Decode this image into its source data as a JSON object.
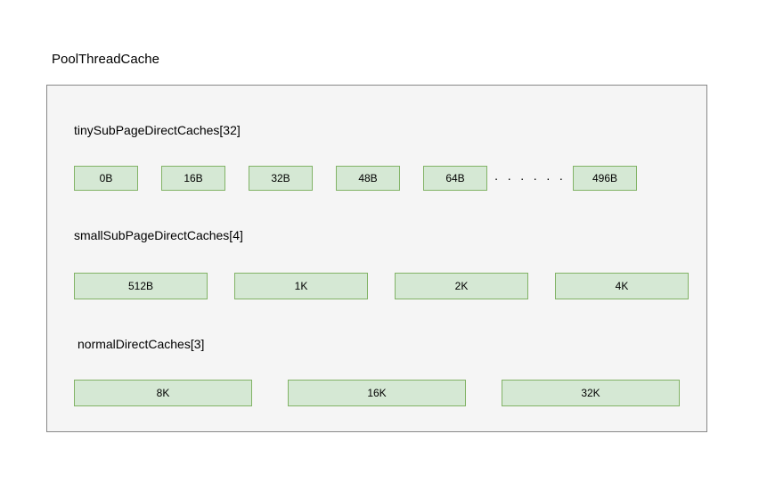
{
  "title": "PoolThreadCache",
  "sections": {
    "tiny": {
      "label": "tinySubPageDirectCaches[32]",
      "cells": [
        "0B",
        "16B",
        "32B",
        "48B",
        "64B"
      ],
      "ellipsis": "· · · · · ·",
      "last": "496B"
    },
    "small": {
      "label": "smallSubPageDirectCaches[4]",
      "cells": [
        "512B",
        "1K",
        "2K",
        "4K"
      ]
    },
    "normal": {
      "label": "normalDirectCaches[3]",
      "cells": [
        "8K",
        "16K",
        "32K"
      ]
    }
  }
}
